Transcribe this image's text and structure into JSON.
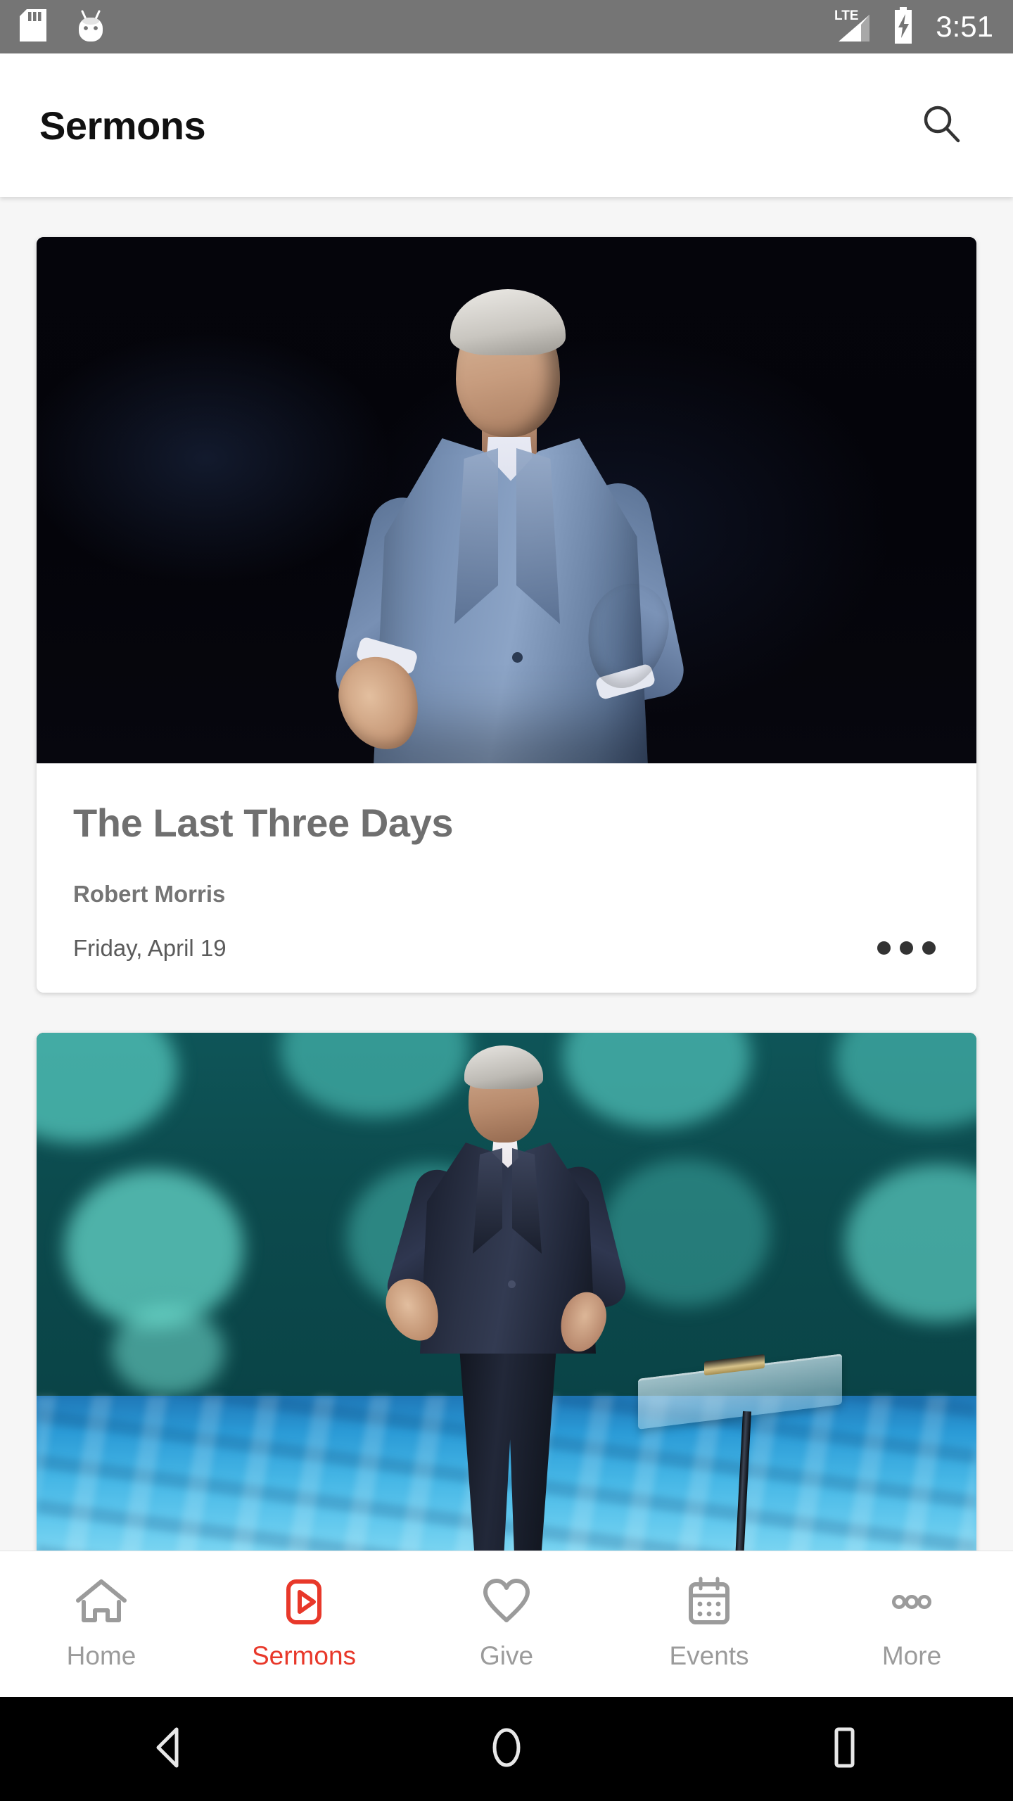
{
  "status_bar": {
    "left_icons": [
      "sd-card-icon",
      "android-mascot-icon"
    ],
    "network_label": "LTE",
    "right_icons": [
      "lte-signal-icon",
      "battery-charging-icon"
    ],
    "time": "3:51",
    "background_color": "#757575",
    "foreground_color": "#ffffff"
  },
  "app_bar": {
    "title": "Sermons",
    "search_icon": "search-icon",
    "background_color": "#ffffff",
    "title_color": "#111111"
  },
  "theme": {
    "page_background": "#f6f6f6",
    "accent_red": "#e8382a",
    "card_background": "#ffffff",
    "muted_text": "#9b9b9b",
    "title_text": "#6f6f6f"
  },
  "sermons": [
    {
      "thumbnail": "speaker-in-light-blue-suit-on-dark-stage",
      "title": "The Last Three Days",
      "speaker": "Robert Morris",
      "date": "Friday, April 19",
      "overflow_icon": "more-horizontal-icon"
    },
    {
      "thumbnail": "speaker-in-dark-suit-on-teal-bokeh-stage-with-podium",
      "title": "",
      "speaker": "",
      "date": "",
      "overflow_icon": "more-horizontal-icon"
    }
  ],
  "tab_bar": {
    "active_index": 1,
    "tabs": [
      {
        "label": "Home",
        "icon": "home-icon"
      },
      {
        "label": "Sermons",
        "icon": "video-play-icon"
      },
      {
        "label": "Give",
        "icon": "heart-icon"
      },
      {
        "label": "Events",
        "icon": "calendar-icon"
      },
      {
        "label": "More",
        "icon": "more-circles-icon"
      }
    ]
  },
  "android_nav": {
    "buttons": [
      "back-button",
      "home-button",
      "recents-button"
    ],
    "background_color": "#000000"
  }
}
